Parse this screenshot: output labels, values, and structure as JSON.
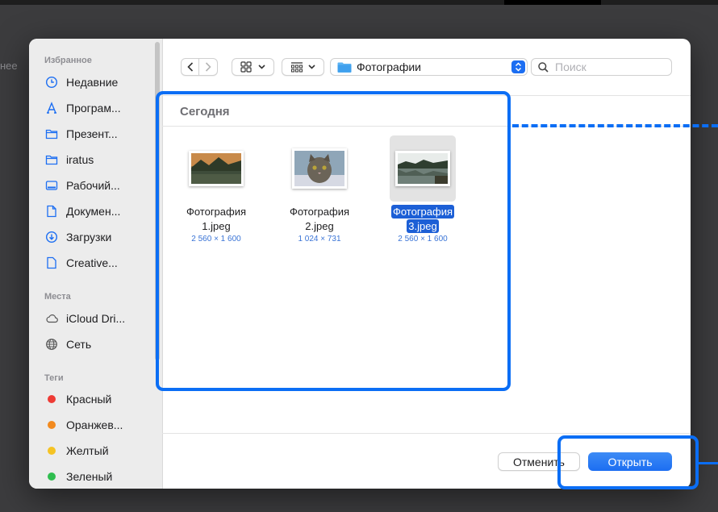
{
  "background": {
    "partial_text": "нее"
  },
  "sidebar": {
    "favorites_title": "Избранное",
    "favorites": [
      {
        "label": "Недавние",
        "icon": "clock-icon"
      },
      {
        "label": "Програм...",
        "icon": "applications-icon"
      },
      {
        "label": "Презент...",
        "icon": "folder-icon"
      },
      {
        "label": "iratus",
        "icon": "folder-icon"
      },
      {
        "label": "Рабочий...",
        "icon": "desktop-icon"
      },
      {
        "label": "Докумен...",
        "icon": "document-icon"
      },
      {
        "label": "Загрузки",
        "icon": "download-icon"
      },
      {
        "label": "Creative...",
        "icon": "file-icon"
      }
    ],
    "places_title": "Места",
    "places": [
      {
        "label": "iCloud Dri...",
        "icon": "cloud-icon"
      },
      {
        "label": "Сеть",
        "icon": "globe-icon"
      }
    ],
    "tags_title": "Теги",
    "tags": [
      {
        "label": "Красный",
        "color": "#ee3b35"
      },
      {
        "label": "Оранжев...",
        "color": "#f28a1e"
      },
      {
        "label": "Желтый",
        "color": "#f5c324"
      },
      {
        "label": "Зеленый",
        "color": "#2fbd4f"
      }
    ]
  },
  "toolbar": {
    "location": "Фотографии",
    "search_placeholder": "Поиск"
  },
  "content": {
    "group_title": "Сегодня",
    "files": [
      {
        "name_line1": "Фотография",
        "name_line2": "1.jpeg",
        "dims": "2 560 × 1 600",
        "selected": false
      },
      {
        "name_line1": "Фотография",
        "name_line2": "2.jpeg",
        "dims": "1 024 × 731",
        "selected": false
      },
      {
        "name_line1": "Фотография",
        "name_line2": "3.jpeg",
        "dims": "2 560 × 1 600",
        "selected": true
      }
    ]
  },
  "footer": {
    "cancel_label": "Отменить",
    "open_label": "Открыть"
  },
  "colors": {
    "accent": "#1c6ef2",
    "annotation": "#0b6ef5"
  }
}
